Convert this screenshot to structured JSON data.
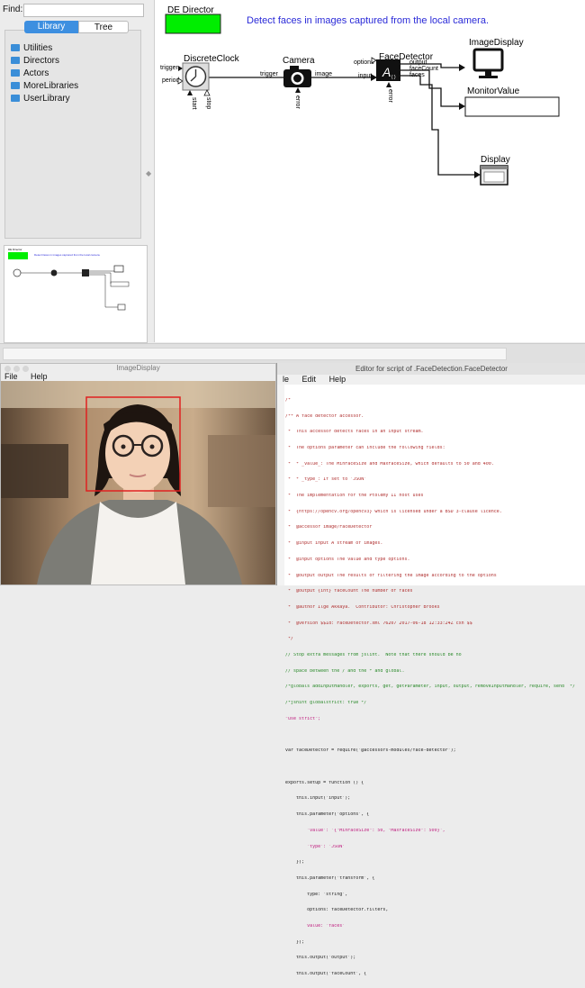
{
  "left_panel": {
    "find_label": "Find:",
    "tabs": [
      "Library",
      "Tree"
    ],
    "library_items": [
      "Utilities",
      "Directors",
      "Actors",
      "MoreLibraries",
      "UserLibrary"
    ]
  },
  "diagram": {
    "director_label": "DE Director",
    "description": "Detect faces in images captured from the local camera.",
    "actors": {
      "clock": "DiscreteClock",
      "camera": "Camera",
      "face_detector": "FaceDetector",
      "image_display": "ImageDisplay",
      "monitor_value": "MonitorValue",
      "display": "Display"
    },
    "ports": {
      "clock_trigger": "trigger",
      "clock_period": "period",
      "clock_start": "start",
      "clock_stop": "stop",
      "camera_trigger": "trigger",
      "camera_image": "image",
      "camera_error": "error",
      "fd_options": "options",
      "fd_input": "input",
      "fd_output": "output",
      "fd_facecount": "faceCount",
      "fd_faces": "faces",
      "fd_error": "error"
    }
  },
  "image_window": {
    "title": "ImageDisplay",
    "menu": [
      "File",
      "Help"
    ]
  },
  "editor": {
    "title": "Editor for script of .FaceDetection.FaceDetector",
    "menu": [
      "le",
      "Edit",
      "Help"
    ],
    "code_lines": [
      "/*",
      "/** A face detector accessor.",
      " *  This accessor detects faces in an input stream.",
      " *  The options parameter can include the following fields:",
      " *  * _value_: The MinFaceSize and MaxFaceSize, which defaults to 50 and 400.",
      " *  * _type_: If set to 'JSON'",
      " *  The implementation for the Ptolemy II host uses",
      " *  {https://opencv.org/opencv3} which is licensed under a BSD 3-clause licence.",
      " *  @accessor image/FaceDetector",
      " *  @input input A stream of images.",
      " *  @input options The value and type options.",
      " *  @output output The results of filtering the image according to the options",
      " *  @output {int} faceCount The number of faces",
      " *  @author Ilge Akkaya.  Contributor: Christopher Brooks",
      " *  @version $$Id: FaceDetector.xml 76207 2017-06-18 12:33:24Z cxh $$",
      " */",
      "// Stop extra messages from jslint.  Note that there should be no",
      "// space between the / and the * and global.",
      "/*globals addInputHandler, exports, get, getParameter, input, output, removeInputHandler, require, send  */",
      "/*jshint globalstrict: true */",
      "\"use strict\";",
      "",
      "var faceDetector = require('@accessors-modules/face-detector');",
      "",
      "exports.setup = function () {",
      "    this.input('input');",
      "    this.parameter('options', {",
      "        'value': '{\"MinFaceSize\": 50, \"MaxFaceSize\": 500}',",
      "        'type': 'JSON'",
      "    });",
      "    this.parameter('transform', {",
      "        type: 'string',",
      "        options: faceDetector.filters,",
      "        value: 'faces'",
      "    });",
      "    this.output('output');",
      "    this.output('faceCount', {"
    ]
  },
  "colors": {
    "director_green": "#00ee00",
    "description_blue": "#2a2ad8",
    "accent_blue": "#3d8fe0",
    "face_box": "#e02020"
  }
}
